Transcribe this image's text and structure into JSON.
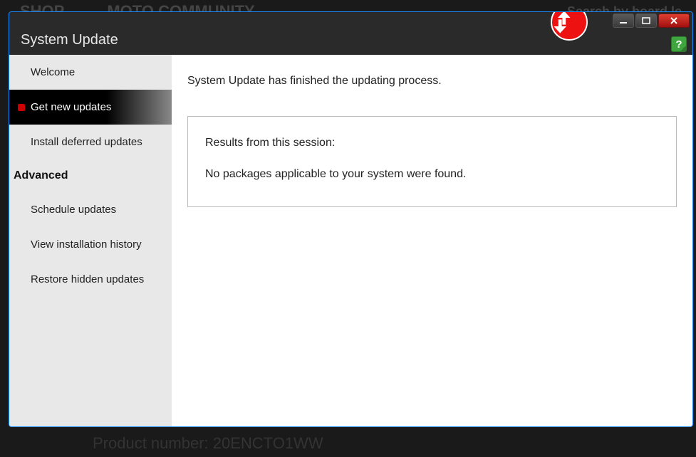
{
  "background": {
    "shop": "SHOP",
    "moto": "MOTO COMMUNITY",
    "search": "Search by board le",
    "product": "Product number: 20ENCTO1WW"
  },
  "window": {
    "title": "System Update",
    "help": "?"
  },
  "sidebar": {
    "welcome": "Welcome",
    "get_new": "Get new updates",
    "install_deferred": "Install deferred updates",
    "advanced_header": "Advanced",
    "schedule": "Schedule updates",
    "history": "View installation history",
    "restore": "Restore hidden updates"
  },
  "main": {
    "status": "System Update has finished the updating process.",
    "results_title": "Results from this session:",
    "results_body": "No packages applicable to your system were found."
  }
}
